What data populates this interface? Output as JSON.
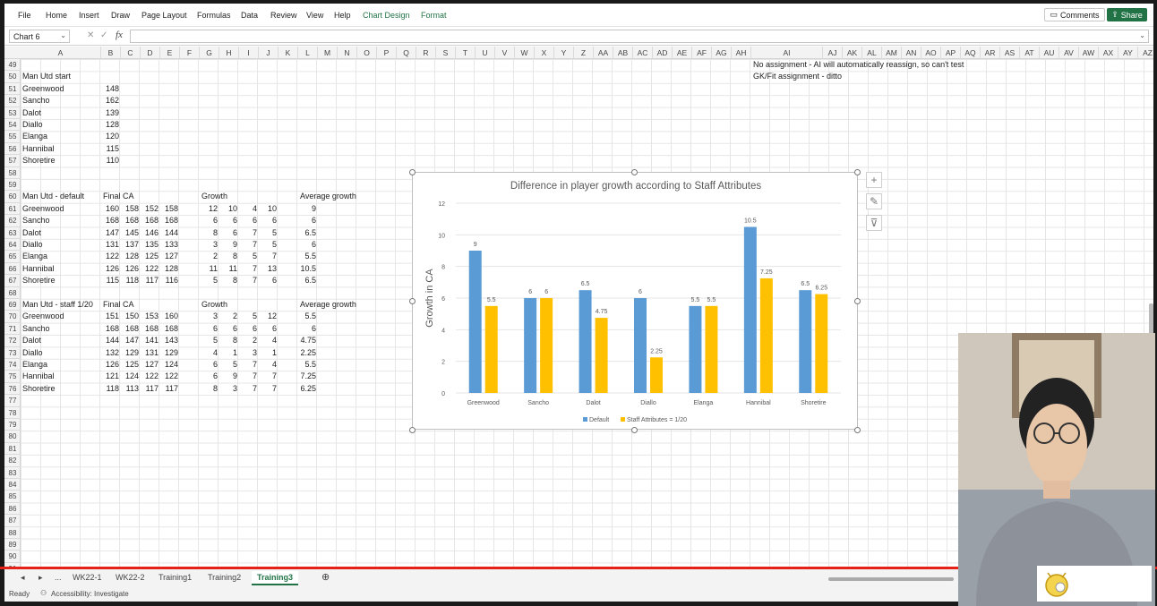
{
  "menu": [
    "File",
    "Home",
    "Insert",
    "Draw",
    "Page Layout",
    "Formulas",
    "Data",
    "Review",
    "View",
    "Help",
    "Chart Design",
    "Format"
  ],
  "comments_label": "Comments",
  "share_label": "Share",
  "namebox": "Chart 6",
  "fx_label": "fx",
  "columns": [
    "A",
    "B",
    "C",
    "D",
    "E",
    "F",
    "G",
    "H",
    "I",
    "J",
    "K",
    "L",
    "M",
    "N",
    "O",
    "P",
    "Q",
    "R",
    "S",
    "T",
    "U",
    "V",
    "W",
    "X",
    "Y",
    "Z",
    "AA",
    "AB",
    "AC",
    "AD",
    "AE",
    "AF",
    "AG",
    "AH",
    "AI",
    "AJ",
    "AK",
    "AL",
    "AM",
    "AN",
    "AO",
    "AP",
    "AQ",
    "AR",
    "AS",
    "AT",
    "AU",
    "AV",
    "AW",
    "AX",
    "AY",
    "AZ"
  ],
  "rows": [
    "49",
    "50",
    "51",
    "52",
    "53",
    "54",
    "55",
    "56",
    "57",
    "58",
    "59",
    "60",
    "61",
    "62",
    "63",
    "64",
    "65",
    "66",
    "67",
    "68",
    "69",
    "70",
    "71",
    "72",
    "73",
    "74",
    "75",
    "76",
    "77",
    "78",
    "79",
    "80",
    "81",
    "82",
    "83",
    "84",
    "85",
    "86",
    "87",
    "88",
    "89",
    "90",
    "91"
  ],
  "notes": {
    "r49": "No assignment - AI will automatically reassign, so can't test",
    "r50": "GK/Fit assignment - ditto"
  },
  "start": {
    "title": "Man Utd start",
    "players": [
      "Greenwood",
      "Sancho",
      "Dalot",
      "Diallo",
      "Elanga",
      "Hannibal",
      "Shoretire"
    ],
    "values": [
      "148",
      "162",
      "139",
      "128",
      "120",
      "115",
      "110"
    ]
  },
  "default_table": {
    "title": "Man Utd - default",
    "final_ca": "Final CA",
    "growth": "Growth",
    "avg": "Average growth",
    "rows": [
      [
        "Greenwood",
        "160",
        "158",
        "152",
        "158",
        "12",
        "10",
        "4",
        "10",
        "9"
      ],
      [
        "Sancho",
        "168",
        "168",
        "168",
        "168",
        "6",
        "6",
        "6",
        "6",
        "6"
      ],
      [
        "Dalot",
        "147",
        "145",
        "146",
        "144",
        "8",
        "6",
        "7",
        "5",
        "6.5"
      ],
      [
        "Diallo",
        "131",
        "137",
        "135",
        "133",
        "3",
        "9",
        "7",
        "5",
        "6"
      ],
      [
        "Elanga",
        "122",
        "128",
        "125",
        "127",
        "2",
        "8",
        "5",
        "7",
        "5.5"
      ],
      [
        "Hannibal",
        "126",
        "126",
        "122",
        "128",
        "11",
        "11",
        "7",
        "13",
        "10.5"
      ],
      [
        "Shoretire",
        "115",
        "118",
        "117",
        "116",
        "5",
        "8",
        "7",
        "6",
        "6.5"
      ]
    ]
  },
  "staff_table": {
    "title": "Man Utd - staff 1/20",
    "final_ca": "Final CA",
    "growth": "Growth",
    "avg": "Average growth",
    "rows": [
      [
        "Greenwood",
        "151",
        "150",
        "153",
        "160",
        "3",
        "2",
        "5",
        "12",
        "5.5"
      ],
      [
        "Sancho",
        "168",
        "168",
        "168",
        "168",
        "6",
        "6",
        "6",
        "6",
        "6"
      ],
      [
        "Dalot",
        "144",
        "147",
        "141",
        "143",
        "5",
        "8",
        "2",
        "4",
        "4.75"
      ],
      [
        "Diallo",
        "132",
        "129",
        "131",
        "129",
        "4",
        "1",
        "3",
        "1",
        "2.25"
      ],
      [
        "Elanga",
        "126",
        "125",
        "127",
        "124",
        "6",
        "5",
        "7",
        "4",
        "5.5"
      ],
      [
        "Hannibal",
        "121",
        "124",
        "122",
        "122",
        "6",
        "9",
        "7",
        "7",
        "7.25"
      ],
      [
        "Shoretire",
        "118",
        "113",
        "117",
        "117",
        "8",
        "3",
        "7",
        "7",
        "6.25"
      ]
    ]
  },
  "chart_data": {
    "type": "bar",
    "title": "Difference in player growth according to Staff Attributes",
    "xlabel": "",
    "ylabel": "Growth in CA",
    "ylim": [
      0,
      12
    ],
    "yticks": [
      "0",
      "2",
      "4",
      "6",
      "8",
      "10",
      "12"
    ],
    "categories": [
      "Greenwood",
      "Sancho",
      "Dalot",
      "Diallo",
      "Elanga",
      "Hannibal",
      "Shoretire"
    ],
    "series": [
      {
        "name": "Default",
        "color": "#5b9bd5",
        "values": [
          9,
          6,
          6.5,
          6,
          5.5,
          10.5,
          6.5
        ],
        "labels": [
          "9",
          "6",
          "6.5",
          "6",
          "5.5",
          "10.5",
          "6.5"
        ]
      },
      {
        "name": "Staff Attributes = 1/20",
        "color": "#ffc000",
        "values": [
          5.5,
          6,
          4.75,
          2.25,
          5.5,
          7.25,
          6.25
        ],
        "labels": [
          "5.5",
          "6",
          "4.75",
          "2.25",
          "5.5",
          "7.25",
          "6.25"
        ]
      }
    ],
    "grid": true,
    "legend": "bottom"
  },
  "tabs": [
    "...",
    "WK22-1",
    "WK22-2",
    "Training1",
    "Training2",
    "Training3"
  ],
  "active_tab": "Training3",
  "status": {
    "ready": "Ready",
    "accessibility": "Accessibility: Investigate"
  }
}
